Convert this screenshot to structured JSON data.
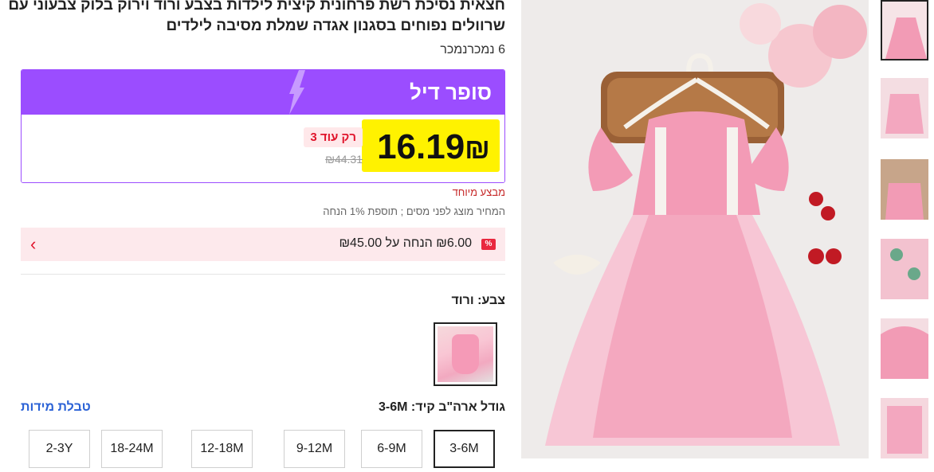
{
  "product": {
    "title": "חצאית נסיכת רשת פרחונית קיצית לילדות בצבע ורוד וירוק בלוק צבעוני עם שרוולים נפוחים בסגנון אגדה שמלת מסיבה לילדים",
    "sold": "6 נמכרנמכר"
  },
  "deal": {
    "label": "סופר דיל",
    "price": "16.19",
    "currency": "₪",
    "badge": "רק עוד 3",
    "original_price": "₪44.31",
    "special_offer": "מבצע מיוחד",
    "tax_note": "המחיר מוצג לפני מסים ; תוספת 1% הנחה"
  },
  "coupon": {
    "badge": "%",
    "text": "₪6.00 הנחה על ₪45.00",
    "arrow": "›"
  },
  "color": {
    "label": "צבע: ורוד"
  },
  "size": {
    "label": "גודל ארה\"ב קיד: 3-6M",
    "chart_link": "טבלת מידות",
    "options": [
      "3-6M",
      "6-9M",
      "9-12M",
      "12-18M",
      "18-24M",
      "2-3Y"
    ],
    "selected": "3-6M"
  },
  "colors": {
    "purple": "#9b4dff",
    "highlight": "#fff200",
    "red": "#e0152c",
    "link": "#2b62d6"
  }
}
